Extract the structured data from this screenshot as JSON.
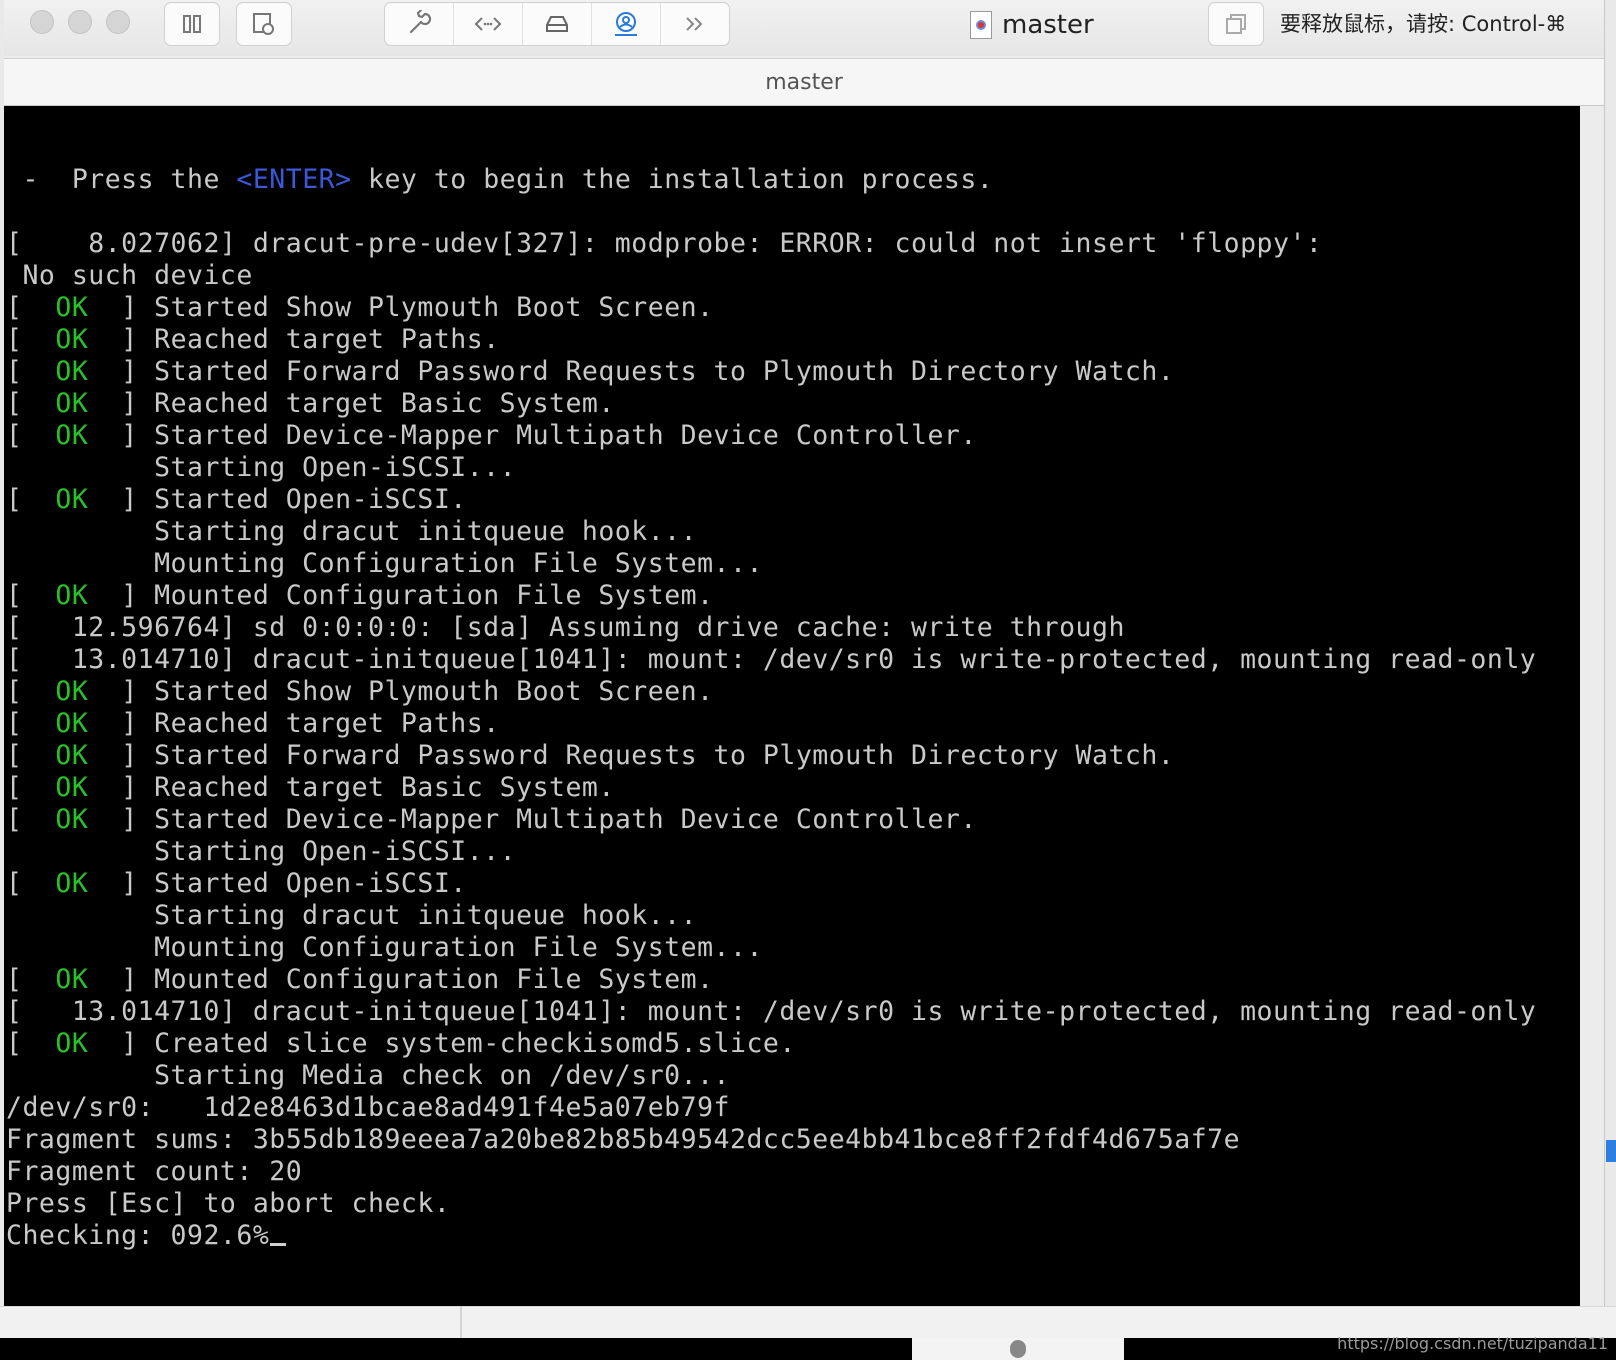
{
  "window": {
    "title": "master",
    "subtitle": "master",
    "release_hint": "要释放鼠标，请按: Control-⌘"
  },
  "toolbar": {
    "icons": [
      "sidebar-toggle-icon",
      "snapshot-icon",
      "wrench-icon",
      "code-icon",
      "drive-icon",
      "user-icon",
      "more-icon",
      "fullscreen-icon"
    ]
  },
  "terminal": {
    "progress_pct": 92.6,
    "lines": [
      [
        {
          "t": " -  Press the "
        },
        {
          "t": "<ENTER>",
          "c": "hl"
        },
        {
          "t": " key to begin the installation process."
        }
      ],
      [
        {
          "t": ""
        }
      ],
      [
        {
          "t": "[    8.027062] dracut-pre-udev[327]: modprobe: ERROR: could not insert 'floppy':"
        }
      ],
      [
        {
          "t": " No such device"
        }
      ],
      [
        {
          "t": "[  "
        },
        {
          "t": "OK",
          "c": "ok"
        },
        {
          "t": "  ] Started Show Plymouth Boot Screen."
        }
      ],
      [
        {
          "t": "[  "
        },
        {
          "t": "OK",
          "c": "ok"
        },
        {
          "t": "  ] Reached target Paths."
        }
      ],
      [
        {
          "t": "[  "
        },
        {
          "t": "OK",
          "c": "ok"
        },
        {
          "t": "  ] Started Forward Password Requests to Plymouth Directory Watch."
        }
      ],
      [
        {
          "t": "[  "
        },
        {
          "t": "OK",
          "c": "ok"
        },
        {
          "t": "  ] Reached target Basic System."
        }
      ],
      [
        {
          "t": "[  "
        },
        {
          "t": "OK",
          "c": "ok"
        },
        {
          "t": "  ] Started Device-Mapper Multipath Device Controller."
        }
      ],
      [
        {
          "t": "         Starting Open-iSCSI..."
        }
      ],
      [
        {
          "t": "[  "
        },
        {
          "t": "OK",
          "c": "ok"
        },
        {
          "t": "  ] Started Open-iSCSI."
        }
      ],
      [
        {
          "t": "         Starting dracut initqueue hook..."
        }
      ],
      [
        {
          "t": "         Mounting Configuration File System..."
        }
      ],
      [
        {
          "t": "[  "
        },
        {
          "t": "OK",
          "c": "ok"
        },
        {
          "t": "  ] Mounted Configuration File System."
        }
      ],
      [
        {
          "t": "[   12.596764] sd 0:0:0:0: [sda] Assuming drive cache: write through"
        }
      ],
      [
        {
          "t": "[   13.014710] dracut-initqueue[1041]: mount: /dev/sr0 is write-protected, mounting read-only"
        }
      ],
      [
        {
          "t": "[  "
        },
        {
          "t": "OK",
          "c": "ok"
        },
        {
          "t": "  ] Started Show Plymouth Boot Screen."
        }
      ],
      [
        {
          "t": "[  "
        },
        {
          "t": "OK",
          "c": "ok"
        },
        {
          "t": "  ] Reached target Paths."
        }
      ],
      [
        {
          "t": "[  "
        },
        {
          "t": "OK",
          "c": "ok"
        },
        {
          "t": "  ] Started Forward Password Requests to Plymouth Directory Watch."
        }
      ],
      [
        {
          "t": "[  "
        },
        {
          "t": "OK",
          "c": "ok"
        },
        {
          "t": "  ] Reached target Basic System."
        }
      ],
      [
        {
          "t": "[  "
        },
        {
          "t": "OK",
          "c": "ok"
        },
        {
          "t": "  ] Started Device-Mapper Multipath Device Controller."
        }
      ],
      [
        {
          "t": "         Starting Open-iSCSI..."
        }
      ],
      [
        {
          "t": "[  "
        },
        {
          "t": "OK",
          "c": "ok"
        },
        {
          "t": "  ] Started Open-iSCSI."
        }
      ],
      [
        {
          "t": "         Starting dracut initqueue hook..."
        }
      ],
      [
        {
          "t": "         Mounting Configuration File System..."
        }
      ],
      [
        {
          "t": "[  "
        },
        {
          "t": "OK",
          "c": "ok"
        },
        {
          "t": "  ] Mounted Configuration File System."
        }
      ],
      [
        {
          "t": "[   13.014710] dracut-initqueue[1041]: mount: /dev/sr0 is write-protected, mounting read-only"
        }
      ],
      [
        {
          "t": "[  "
        },
        {
          "t": "OK",
          "c": "ok"
        },
        {
          "t": "  ] Created slice system-checkisomd5.slice."
        }
      ],
      [
        {
          "t": "         Starting Media check on /dev/sr0..."
        }
      ],
      [
        {
          "t": "/dev/sr0:   1d2e8463d1bcae8ad491f4e5a07eb79f"
        }
      ],
      [
        {
          "t": "Fragment sums: 3b55db189eeea7a20be82b85b49542dcc5ee4bb41bce8ff2fdf4d675af7e"
        }
      ],
      [
        {
          "t": "Fragment count: 20"
        }
      ],
      [
        {
          "t": "Press [Esc] to abort check."
        }
      ],
      [
        {
          "t": "Checking: 092.6%"
        }
      ]
    ]
  },
  "watermark": "https://blog.csdn.net/tuzipanda11"
}
